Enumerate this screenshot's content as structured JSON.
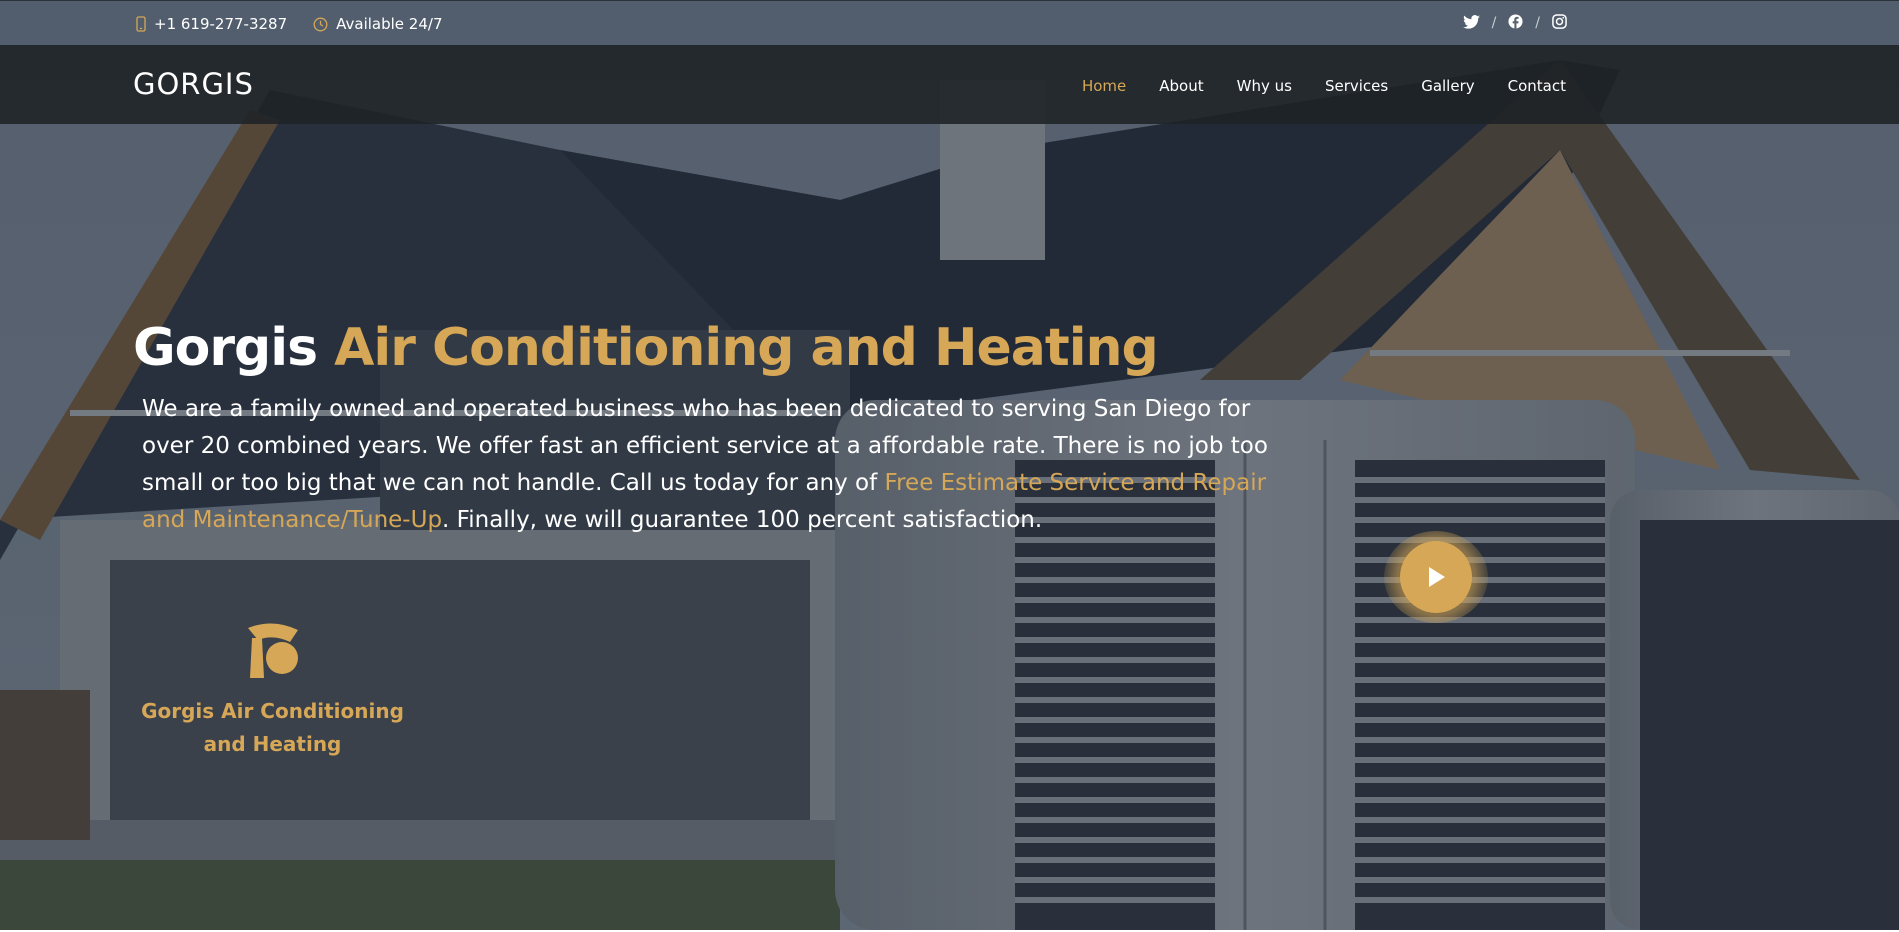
{
  "topbar": {
    "phone": "+1 619-277-3287",
    "availability": "Available 24/7",
    "social": [
      {
        "name": "twitter-icon"
      },
      {
        "name": "facebook-icon"
      },
      {
        "name": "instagram-icon"
      }
    ],
    "separator": "/"
  },
  "header": {
    "logo": "GORGIS",
    "nav": [
      {
        "label": "Home",
        "active": true
      },
      {
        "label": "About"
      },
      {
        "label": "Why us"
      },
      {
        "label": "Services"
      },
      {
        "label": "Gallery"
      },
      {
        "label": "Contact"
      }
    ]
  },
  "hero": {
    "title_main": "Gorgis",
    "title_accent": "Air Conditioning and Heating",
    "text_before": "We are a family owned and operated business who has been dedicated to serving San Diego for over 20 combined years. We offer fast an efficient service at a affordable rate. There is no job too small or too big that we can not handle. Call us today for any of ",
    "text_highlight": "Free Estimate Service and Repair and Maintenance/Tune-Up",
    "text_after": ". Finally, we will guarantee 100 percent satisfaction.",
    "brand_glyph": "G",
    "brand_line1": "Gorgis Air Conditioning",
    "brand_line2": "and Heating"
  },
  "colors": {
    "accent": "#d6a756",
    "header_bg": "#1e2226",
    "text": "#ffffff"
  }
}
